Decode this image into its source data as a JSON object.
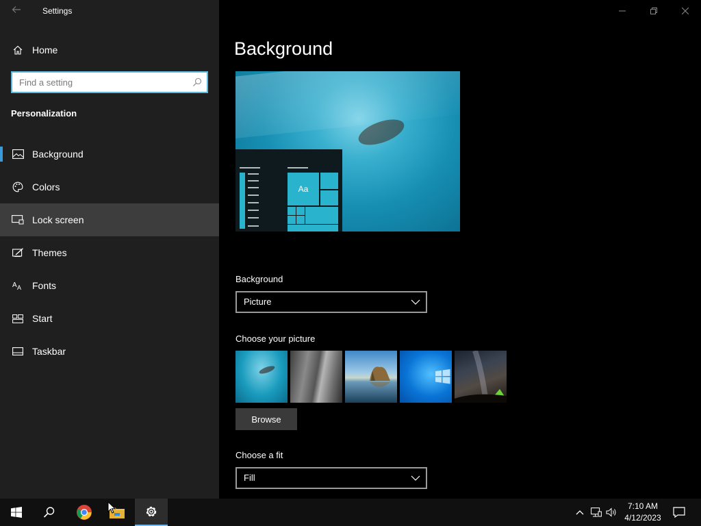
{
  "window": {
    "title": "Settings",
    "back_icon": "back-arrow-icon",
    "controls": [
      "minimize-icon",
      "restore-icon",
      "close-icon"
    ]
  },
  "sidebar": {
    "home_label": "Home",
    "search_placeholder": "Find a setting",
    "section_title": "Personalization",
    "items": [
      {
        "label": "Background",
        "icon": "picture-icon",
        "selected": true
      },
      {
        "label": "Colors",
        "icon": "palette-icon"
      },
      {
        "label": "Lock screen",
        "icon": "lock-screen-icon",
        "hovered": true
      },
      {
        "label": "Themes",
        "icon": "brush-icon"
      },
      {
        "label": "Fonts",
        "icon": "font-icon"
      },
      {
        "label": "Start",
        "icon": "start-layout-icon"
      },
      {
        "label": "Taskbar",
        "icon": "taskbar-icon"
      }
    ]
  },
  "main": {
    "page_title": "Background",
    "preview_tile_text": "Aa",
    "background_label": "Background",
    "background_value": "Picture",
    "choose_picture_label": "Choose your picture",
    "pictures": [
      "underwater-swimmer",
      "rock-cliff",
      "beach-rocks-reflection",
      "windows-logo-blue",
      "night-sky-tent"
    ],
    "browse_label": "Browse",
    "fit_label": "Choose a fit",
    "fit_value": "Fill"
  },
  "taskbar": {
    "apps": [
      "start-icon",
      "search-icon",
      "chrome-icon",
      "file-explorer-icon",
      "settings-icon"
    ],
    "active_app": "settings-icon",
    "tray": [
      "chevron-up-icon",
      "network-icon",
      "volume-icon"
    ],
    "time": "7:10 AM",
    "date": "4/12/2023",
    "notification_icon": "notification-icon"
  },
  "colors": {
    "accent": "#3a9bdc",
    "sidebar_bg": "#1f1f1f",
    "content_bg": "#000000",
    "hover_bg": "#3d3d3d",
    "search_border": "#5bb8e0"
  }
}
